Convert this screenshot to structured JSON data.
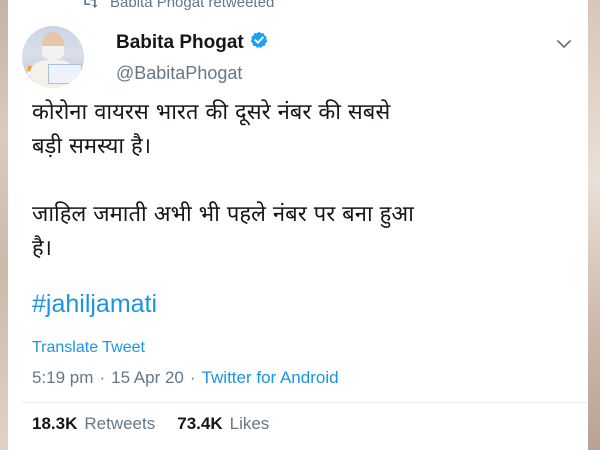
{
  "retweet": {
    "label": "Babita Phogat retweeted",
    "icon": "retweet-icon"
  },
  "author": {
    "name": "Babita Phogat",
    "handle": "@BabitaPhogat",
    "verified_icon": "verified-badge-icon",
    "verified_color": "#1da1f2"
  },
  "tweet": {
    "line1": "कोरोना वायरस भारत की दूसरे नंबर की सबसे",
    "line2": "बड़ी समस्या है।",
    "line3": "जाहिल जमाती अभी भी पहले नंबर पर बना हुआ",
    "line4": "है।",
    "hashtag": "#jahiljamati"
  },
  "translate_label": "Translate Tweet",
  "meta": {
    "time": "5:19 pm",
    "sep1": "·",
    "date": "15 Apr 20",
    "sep2": "·",
    "source": "Twitter for Android"
  },
  "stats": {
    "retweets_count": "18.3K",
    "retweets_label": "Retweets",
    "likes_count": "73.4K",
    "likes_label": "Likes"
  },
  "colors": {
    "link": "#1b95e0",
    "muted": "#657786",
    "text": "#14171a"
  }
}
